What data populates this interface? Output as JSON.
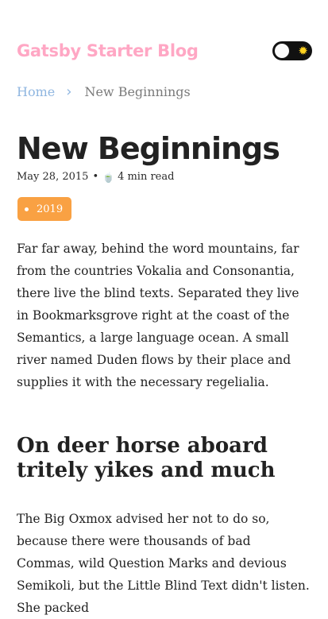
{
  "site": {
    "title": "Gatsby Starter Blog"
  },
  "theme_toggle": {
    "icon_off": "moon-knob",
    "icon_on": "sun-icon",
    "sun_glyph": "✹"
  },
  "breadcrumb": {
    "home": "Home",
    "separator": "›",
    "current": "New Beginnings"
  },
  "post": {
    "title": "New Beginnings",
    "date": "May 28, 2015",
    "bullet": "•",
    "read_icon": "🍵",
    "read_time": "4 min read",
    "tag": "2019",
    "paragraph1": "Far far away, behind the word mountains, far from the countries Vokalia and Consonantia, there live the blind texts. Separated they live in Bookmarksgrove right at the coast of the Semantics, a large language ocean. A small river named Duden flows by their place and supplies it with the necessary regelialia.",
    "subheading": "On deer horse aboard tritely yikes and much",
    "paragraph2": "The Big Oxmox advised her not to do so, because there were thousands of bad Commas, wild Question Marks and devious Semikoli, but the Little Blind Text didn't listen. She packed"
  },
  "colors": {
    "brand": "#ffa7c4",
    "link": "#8fb6e0",
    "tag": "#f9a143"
  }
}
